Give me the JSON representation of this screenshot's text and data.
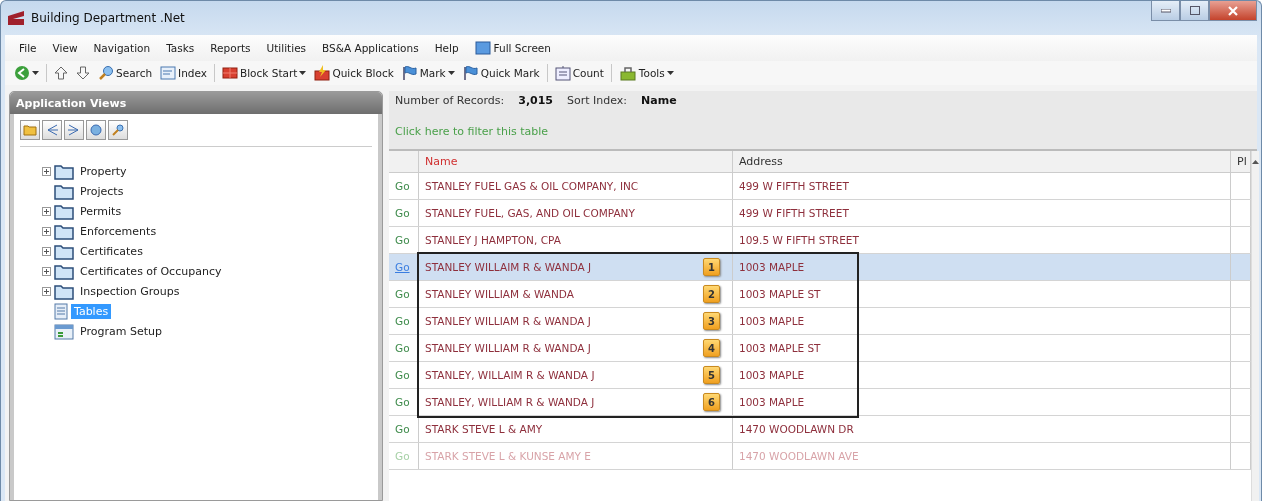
{
  "window": {
    "title": "Building Department .Net"
  },
  "menu": {
    "items": [
      "File",
      "View",
      "Navigation",
      "Tasks",
      "Reports",
      "Utilities",
      "BS&A Applications",
      "Help"
    ],
    "full_screen": "Full Screen"
  },
  "toolbar": [
    {
      "kind": "back",
      "dropdown": true
    },
    {
      "kind": "separator"
    },
    {
      "kind": "up",
      "dropdown": false
    },
    {
      "kind": "down",
      "dropdown": false
    },
    {
      "kind": "search",
      "label": "Search",
      "dropdown": false
    },
    {
      "kind": "index",
      "label": "Index",
      "dropdown": false
    },
    {
      "kind": "separator"
    },
    {
      "kind": "block",
      "label": "Block Start",
      "dropdown": true
    },
    {
      "kind": "quickblock",
      "label": "Quick Block",
      "dropdown": false
    },
    {
      "kind": "flag",
      "label": "Mark",
      "dropdown": true
    },
    {
      "kind": "flag",
      "label": "Quick Mark",
      "dropdown": false
    },
    {
      "kind": "separator"
    },
    {
      "kind": "count",
      "label": "Count",
      "dropdown": false
    },
    {
      "kind": "separator"
    },
    {
      "kind": "tools",
      "label": "Tools",
      "dropdown": true
    }
  ],
  "sidebar": {
    "title": "Application Views",
    "items": [
      {
        "label": "Property",
        "kind": "folder",
        "expandable": true,
        "selected": false
      },
      {
        "label": "Projects",
        "kind": "folder",
        "expandable": false,
        "selected": false
      },
      {
        "label": "Permits",
        "kind": "folder",
        "expandable": true,
        "selected": false
      },
      {
        "label": "Enforcements",
        "kind": "folder",
        "expandable": true,
        "selected": false
      },
      {
        "label": "Certificates",
        "kind": "folder",
        "expandable": true,
        "selected": false
      },
      {
        "label": "Certificates of Occupancy",
        "kind": "folder",
        "expandable": true,
        "selected": false
      },
      {
        "label": "Inspection Groups",
        "kind": "folder",
        "expandable": true,
        "selected": false
      },
      {
        "label": "Tables",
        "kind": "table",
        "expandable": false,
        "selected": true
      },
      {
        "label": "Program Setup",
        "kind": "setup",
        "expandable": false,
        "selected": false
      }
    ]
  },
  "info": {
    "records_label": "Number of Records:",
    "records": "3,015",
    "sort_label": "Sort Index:",
    "sort": "Name",
    "filter_link": "Click here to filter this table"
  },
  "table": {
    "columns": [
      {
        "label": "Name",
        "sorted": true
      },
      {
        "label": "Address",
        "sorted": false
      },
      {
        "label": "Pl",
        "sorted": false
      }
    ],
    "rows": [
      {
        "go": "Go",
        "name": "STANLEY FUEL GAS & OIL COMPANY, INC",
        "address": "499 W FIFTH STREET",
        "selected": false,
        "dimmed": false
      },
      {
        "go": "Go",
        "name": "STANLEY FUEL, GAS, AND OIL COMPANY",
        "address": "499 W FIFTH STREET",
        "selected": false,
        "dimmed": false
      },
      {
        "go": "Go",
        "name": "STANLEY J HAMPTON, CPA",
        "address": "109.5 W FIFTH STREET",
        "selected": false,
        "dimmed": false
      },
      {
        "go": "Go",
        "name": "STANLEY WILLAIM R & WANDA J",
        "badge": "1",
        "address": "1003 MAPLE",
        "selected": true,
        "dimmed": false
      },
      {
        "go": "Go",
        "name": "STANLEY WILLIAM & WANDA",
        "badge": "2",
        "address": "1003 MAPLE ST",
        "selected": false,
        "dimmed": false
      },
      {
        "go": "Go",
        "name": "STANLEY WILLIAM R & WANDA J",
        "badge": "3",
        "address": "1003 MAPLE",
        "selected": false,
        "dimmed": false
      },
      {
        "go": "Go",
        "name": "STANLEY WILLIAM R & WANDA J",
        "badge": "4",
        "address": "1003 MAPLE ST",
        "selected": false,
        "dimmed": false
      },
      {
        "go": "Go",
        "name": "STANLEY, WILLAIM R & WANDA J",
        "badge": "5",
        "address": "1003 MAPLE",
        "selected": false,
        "dimmed": false
      },
      {
        "go": "Go",
        "name": "STANLEY, WILLIAM R & WANDA J",
        "badge": "6",
        "address": "1003 MAPLE",
        "selected": false,
        "dimmed": false
      },
      {
        "go": "Go",
        "name": "STARK STEVE L & AMY",
        "address": "1470 WOODLAWN DR",
        "selected": false,
        "dimmed": false
      },
      {
        "go": "Go",
        "name": "STARK STEVE L & KUNSE AMY E",
        "address": "1470 WOODLAWN AVE",
        "selected": false,
        "dimmed": true
      }
    ]
  }
}
